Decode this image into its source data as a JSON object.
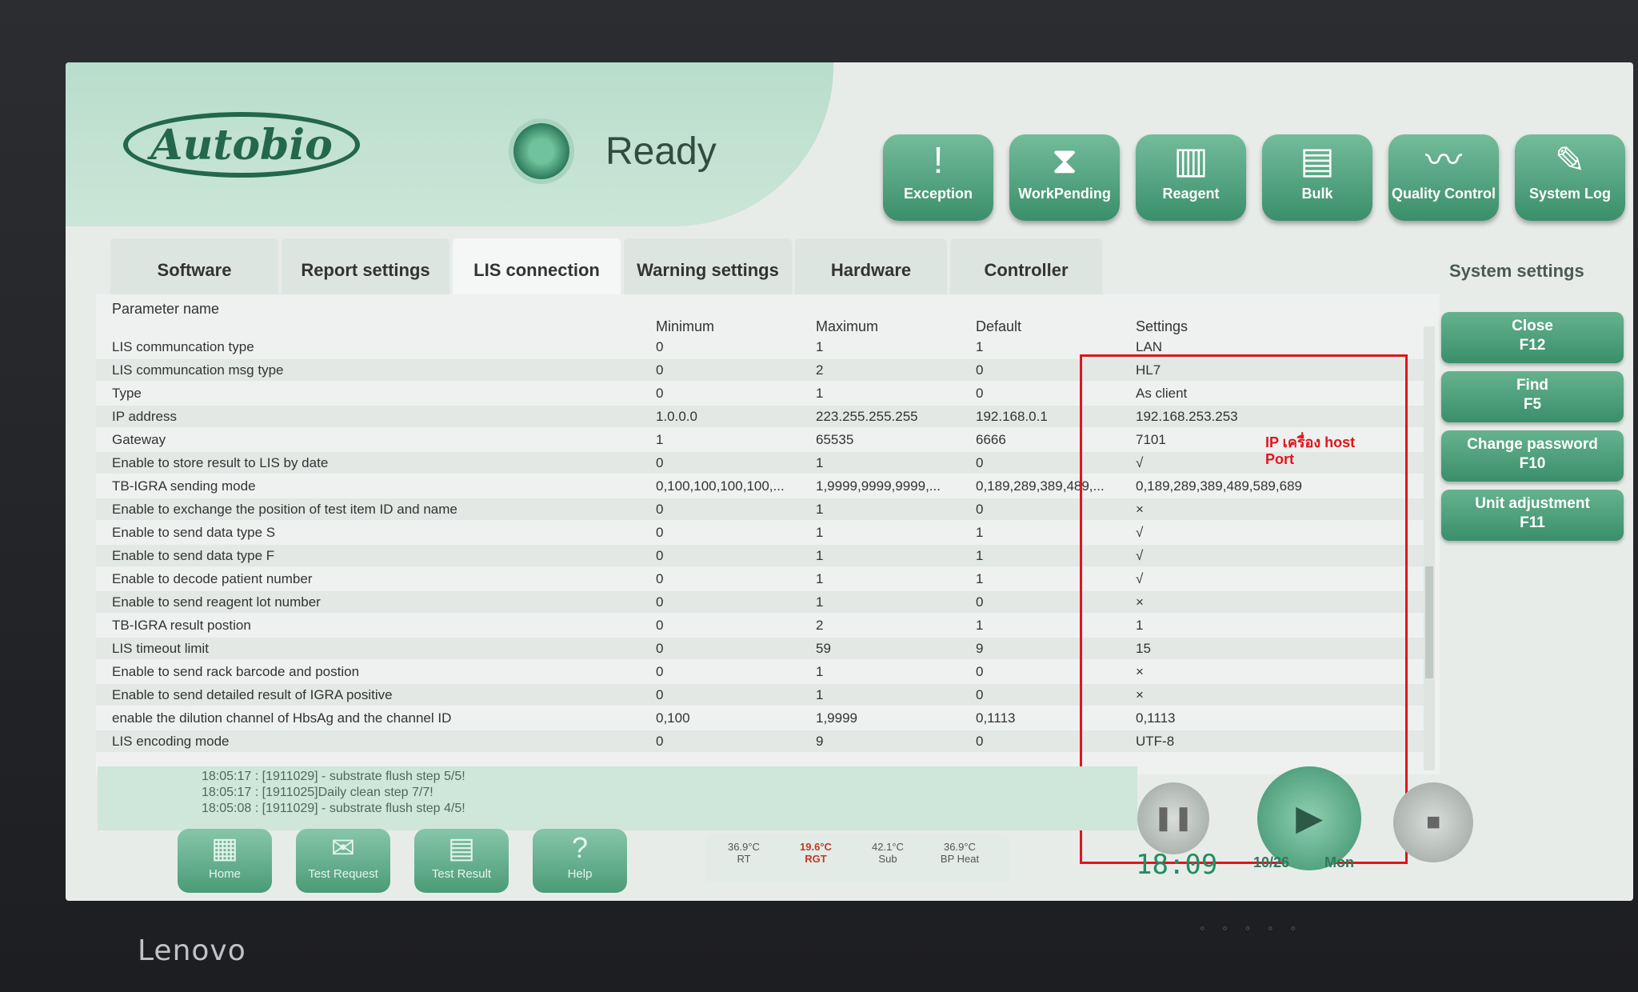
{
  "status": {
    "text": "Ready"
  },
  "logo": {
    "text": "Autobio"
  },
  "toolbar": [
    {
      "label": "Exception",
      "icon": "exclamation-icon"
    },
    {
      "label": "WorkPending",
      "icon": "hourglass-icon"
    },
    {
      "label": "Reagent",
      "icon": "reagent-rack-icon"
    },
    {
      "label": "Bulk",
      "icon": "bulk-icon"
    },
    {
      "label": "Quality Control",
      "icon": "chart-icon"
    },
    {
      "label": "System Log",
      "icon": "document-icon"
    }
  ],
  "tabs": [
    {
      "label": "Software"
    },
    {
      "label": "Report settings"
    },
    {
      "label": "LIS connection",
      "active": true
    },
    {
      "label": "Warning settings"
    },
    {
      "label": "Hardware"
    },
    {
      "label": "Controller"
    }
  ],
  "section_title": "System settings",
  "table": {
    "headers": {
      "name": "Parameter name",
      "min": "Minimum",
      "max": "Maximum",
      "def": "Default",
      "set": "Settings"
    },
    "rows": [
      [
        "LIS communcation type",
        "0",
        "1",
        "1",
        "LAN"
      ],
      [
        "LIS communcation msg type",
        "0",
        "2",
        "0",
        "HL7"
      ],
      [
        "Type",
        "0",
        "1",
        "0",
        "As client"
      ],
      [
        "IP address",
        "1.0.0.0",
        "223.255.255.255",
        "192.168.0.1",
        "192.168.253.253"
      ],
      [
        "Gateway",
        "1",
        "65535",
        "6666",
        "7101"
      ],
      [
        "Enable to store result to LIS by date",
        "0",
        "1",
        "0",
        "√"
      ],
      [
        "TB-IGRA sending mode",
        "0,100,100,100,100,...",
        "1,9999,9999,9999,...",
        "0,189,289,389,489,...",
        "0,189,289,389,489,589,689"
      ],
      [
        "Enable to exchange the position of  test item ID and name",
        "0",
        "1",
        "0",
        "×"
      ],
      [
        "Enable to send data type S",
        "0",
        "1",
        "1",
        "√"
      ],
      [
        "Enable to send data type F",
        "0",
        "1",
        "1",
        "√"
      ],
      [
        "Enable to decode patient number",
        "0",
        "1",
        "1",
        "√"
      ],
      [
        "Enable to send reagent lot number",
        "0",
        "1",
        "0",
        "×"
      ],
      [
        "TB-IGRA result postion",
        "0",
        "2",
        "1",
        "1"
      ],
      [
        "LIS timeout limit",
        "0",
        "59",
        "9",
        "15"
      ],
      [
        "Enable to send rack barcode and postion",
        "0",
        "1",
        "0",
        "×"
      ],
      [
        "Enable to send detailed result of IGRA positive",
        "0",
        "1",
        "0",
        "×"
      ],
      [
        "enable the dilution channel of HbsAg and the channel ID",
        "0,100",
        "1,9999",
        "0,1113",
        "0,1113"
      ],
      [
        "LIS encoding mode",
        "0",
        "9",
        "0",
        "UTF-8"
      ]
    ]
  },
  "side_buttons": [
    {
      "label": "Close",
      "key": "F12"
    },
    {
      "label": "Find",
      "key": "F5"
    },
    {
      "label": "Change password",
      "key": "F10"
    },
    {
      "label": "Unit adjustment",
      "key": "F11"
    }
  ],
  "annotation": {
    "ip_label": "IP เครื่อง host",
    "port_label": "Port",
    "color": "#e2141c"
  },
  "log": [
    "18:05:17 : [1911029] - substrate flush step 5/5!",
    "18:05:17 : [1911025]Daily clean step 7/7!",
    "18:05:08 : [1911029] - substrate flush step 4/5!"
  ],
  "nav": [
    {
      "label": "Home",
      "icon": "home-icon"
    },
    {
      "label": "Test Request",
      "icon": "envelope-icon"
    },
    {
      "label": "Test Result",
      "icon": "document-icon"
    },
    {
      "label": "Help",
      "icon": "help-icon"
    }
  ],
  "temperatures": [
    {
      "value": "36.9°C",
      "label": "RT"
    },
    {
      "value": "19.6°C",
      "label": "RGT"
    },
    {
      "value": "42.1°C",
      "label": "Sub"
    },
    {
      "value": "36.9°C",
      "label": "BP Heat"
    }
  ],
  "clock": {
    "time": "18:09",
    "date": "10/26",
    "day": "Mon"
  },
  "monitor_brand": "Lenovo",
  "theme": {
    "accent": "#3a8f6a",
    "header": "#b9ddcc"
  }
}
